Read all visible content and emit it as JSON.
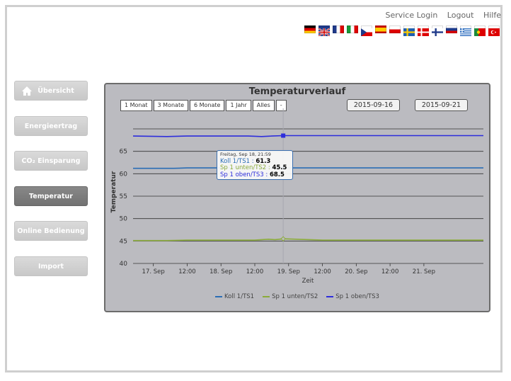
{
  "header": {
    "links": [
      "Service Login",
      "Logout",
      "Hilfe"
    ],
    "flags": [
      "de-flag-icon",
      "gb-flag-icon",
      "fr-flag-icon",
      "it-flag-icon",
      "cz-flag-icon",
      "es-flag-icon",
      "pl-flag-icon",
      "se-flag-icon",
      "dk-flag-icon",
      "fi-flag-icon",
      "ru-flag-icon",
      "gr-flag-icon",
      "pt-flag-icon",
      "tr-flag-icon"
    ]
  },
  "sidebar": {
    "items": [
      {
        "label": "Übersicht",
        "icon": "home-icon"
      },
      {
        "label": "Energieertrag"
      },
      {
        "label": "CO₂ Einsparung"
      },
      {
        "label": "Temperatur",
        "active": true
      },
      {
        "label": "Online Bedienung"
      },
      {
        "label": "Import"
      }
    ]
  },
  "chart": {
    "title": "Temperaturverlauf",
    "zoom_buttons": [
      "1 Monat",
      "3 Monate",
      "6 Monate",
      "1 Jahr",
      "Alles",
      "-"
    ],
    "date_from": "2015-09-16",
    "date_to": "2015-09-21",
    "tooltip": {
      "date": "Freitag, Sep 18, 21:59",
      "rows": [
        {
          "label": "Koll 1/TS1 :",
          "value": "61.3",
          "color": "#2a6db5"
        },
        {
          "label": "Sp 1 unten/TS2 :",
          "value": "45.5",
          "color": "#8bab3a"
        },
        {
          "label": "Sp 1 oben/TS3 :",
          "value": "68.5",
          "color": "#2d2ddc"
        }
      ]
    }
  },
  "chart_data": {
    "type": "line",
    "title": "Temperaturverlauf",
    "xlabel": "Zeit",
    "ylabel": "Temperatur",
    "ylim": [
      40,
      70
    ],
    "yticks": [
      40,
      45,
      50,
      55,
      60,
      65
    ],
    "xlim": [
      16.7,
      21.88
    ],
    "xtick_positions": [
      17,
      17.5,
      18,
      18.5,
      19,
      19.5,
      20,
      20.5,
      21
    ],
    "xtick_labels": [
      "17. Sep",
      "12:00",
      "18. Sep",
      "12:00",
      "19. Sep",
      "12:00",
      "20. Sep",
      "12:00",
      "21. Sep"
    ],
    "grid": true,
    "legend": "bottom",
    "crosshair_x": 18.92,
    "series": [
      {
        "name": "Koll 1/TS1",
        "color": "#2a6db5",
        "x": [
          16.7,
          17.3,
          17.5,
          18.0,
          18.5,
          18.92,
          19.5,
          20.5,
          21.88
        ],
        "y": [
          61.2,
          61.2,
          61.3,
          61.3,
          61.3,
          61.3,
          61.3,
          61.3,
          61.3
        ]
      },
      {
        "name": "Sp 1 unten/TS2",
        "color": "#8bab3a",
        "x": [
          16.7,
          17.2,
          17.5,
          18.0,
          18.5,
          18.7,
          18.8,
          18.92,
          19.5,
          20.5,
          21.88
        ],
        "y": [
          45.1,
          45.1,
          45.2,
          45.2,
          45.2,
          45.4,
          45.3,
          45.5,
          45.2,
          45.2,
          45.2
        ]
      },
      {
        "name": "Sp 1 oben/TS3",
        "color": "#2d2ddc",
        "x": [
          16.7,
          17.2,
          17.5,
          18.0,
          18.4,
          18.6,
          18.75,
          18.92,
          19.5,
          20.5,
          21.88
        ],
        "y": [
          68.4,
          68.3,
          68.4,
          68.4,
          68.4,
          68.3,
          68.4,
          68.5,
          68.5,
          68.5,
          68.5
        ]
      }
    ]
  }
}
